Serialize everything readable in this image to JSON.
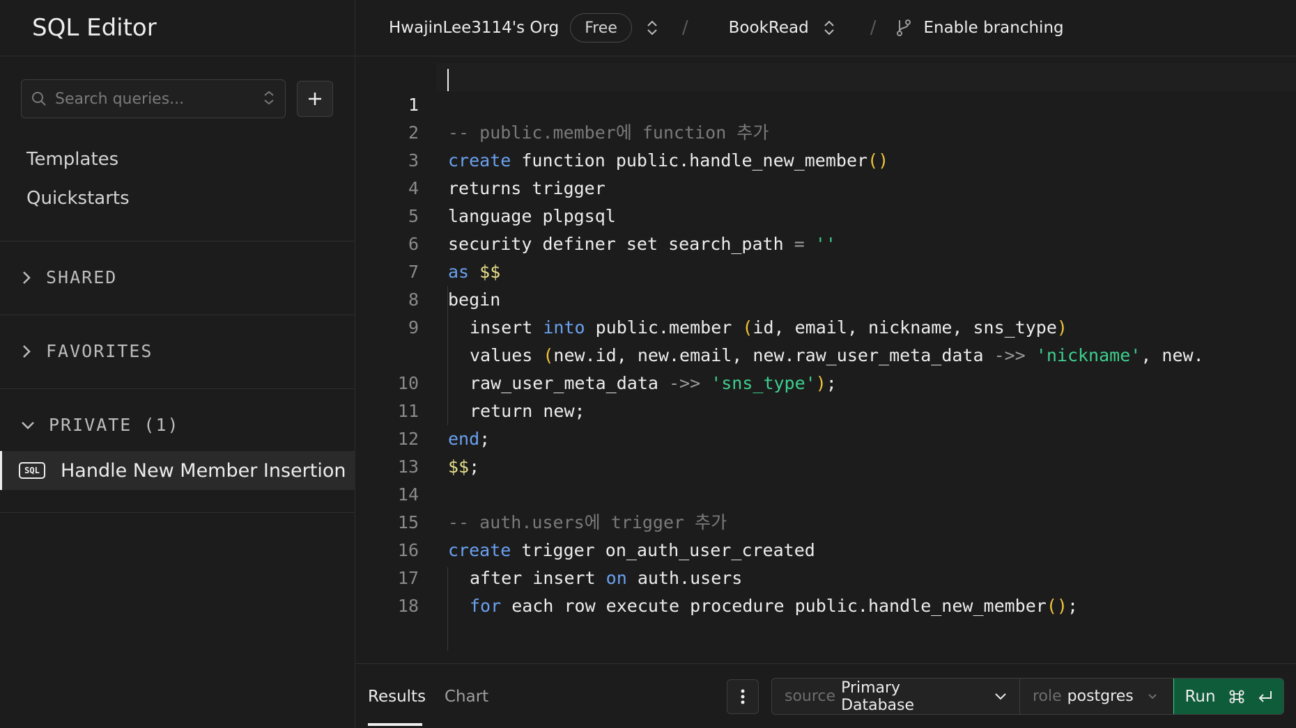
{
  "sidebar": {
    "title": "SQL Editor",
    "search": {
      "placeholder": "Search queries..."
    },
    "links": [
      "Templates",
      "Quickstarts"
    ],
    "sections": {
      "shared": "SHARED",
      "favorites": "FAVORITES",
      "private": "PRIVATE (1)"
    },
    "queries": [
      {
        "label": "Handle New Member Insertion",
        "badge": "SQL"
      }
    ]
  },
  "topbar": {
    "org": "HwajinLee3114's Org",
    "plan": "Free",
    "project": "BookRead",
    "branching": "Enable branching"
  },
  "editor": {
    "active_line": 1,
    "lines": [
      {
        "n": "1",
        "text": "-- public.member에 function 추가"
      },
      {
        "n": "2",
        "text": "create function public.handle_new_member()"
      },
      {
        "n": "3",
        "text": "returns trigger"
      },
      {
        "n": "4",
        "text": "language plpgsql"
      },
      {
        "n": "5",
        "text": "security definer set search_path = ''"
      },
      {
        "n": "6",
        "text": "as $$"
      },
      {
        "n": "7",
        "text": "begin"
      },
      {
        "n": "8",
        "text": "insert into public.member (id, email, nickname, sns_type)"
      },
      {
        "n": "9",
        "text": "values (new.id, new.email, new.raw_user_meta_data ->> 'nickname', new."
      },
      {
        "n": "",
        "text": "raw_user_meta_data ->> 'sns_type');"
      },
      {
        "n": "10",
        "text": "return new;"
      },
      {
        "n": "11",
        "text": "end;"
      },
      {
        "n": "12",
        "text": "$$;"
      },
      {
        "n": "13",
        "text": ""
      },
      {
        "n": "14",
        "text": "-- auth.users에 trigger 추가"
      },
      {
        "n": "15",
        "text": "create trigger on_auth_user_created"
      },
      {
        "n": "16",
        "text": "after insert on auth.users"
      },
      {
        "n": "17",
        "text": "for each row execute procedure public.handle_new_member();"
      },
      {
        "n": "18",
        "text": ""
      }
    ]
  },
  "bottombar": {
    "tabs": [
      "Results",
      "Chart"
    ],
    "source_label": "source",
    "source_value": "Primary Database",
    "role_label": "role",
    "role_value": "postgres",
    "run_label": "Run"
  },
  "colors": {
    "keyword": "#6aa1f0",
    "string": "#3ecf8e",
    "comment": "#7a7a7a",
    "paren": "#f0c43a",
    "run_button": "#0e5c3a"
  }
}
